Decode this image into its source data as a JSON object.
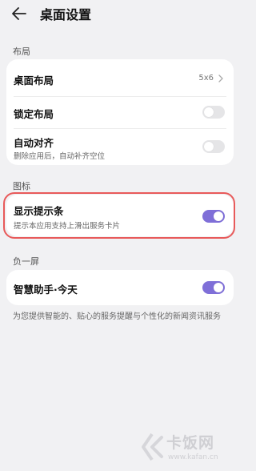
{
  "header": {
    "title": "桌面设置",
    "back_icon": "arrow-left-icon"
  },
  "sections": {
    "layout": {
      "label": "布局",
      "items": [
        {
          "title": "桌面布局",
          "value": "5x6",
          "icon": "chevron-right-icon"
        },
        {
          "title": "锁定布局",
          "toggle": false
        },
        {
          "title": "自动对齐",
          "subtitle": "删除应用后，自动补齐空位",
          "toggle": false
        }
      ]
    },
    "icons": {
      "label": "图标",
      "items": [
        {
          "title": "显示提示条",
          "subtitle": "提示本应用支持上滑出服务卡片",
          "toggle": true
        }
      ]
    },
    "minus_one": {
      "label": "负一屏",
      "items": [
        {
          "title": "智慧助手·今天",
          "toggle": true
        }
      ],
      "note": "为您提供智能的、贴心的服务提醒与个性化的新闻资讯服务"
    }
  },
  "colors": {
    "accent": "#7f6fd8",
    "highlight": "#e85a5a",
    "background": "#f1f1f3"
  },
  "watermark": {
    "brand": "卡饭网",
    "url": "www.kafan.cn"
  }
}
